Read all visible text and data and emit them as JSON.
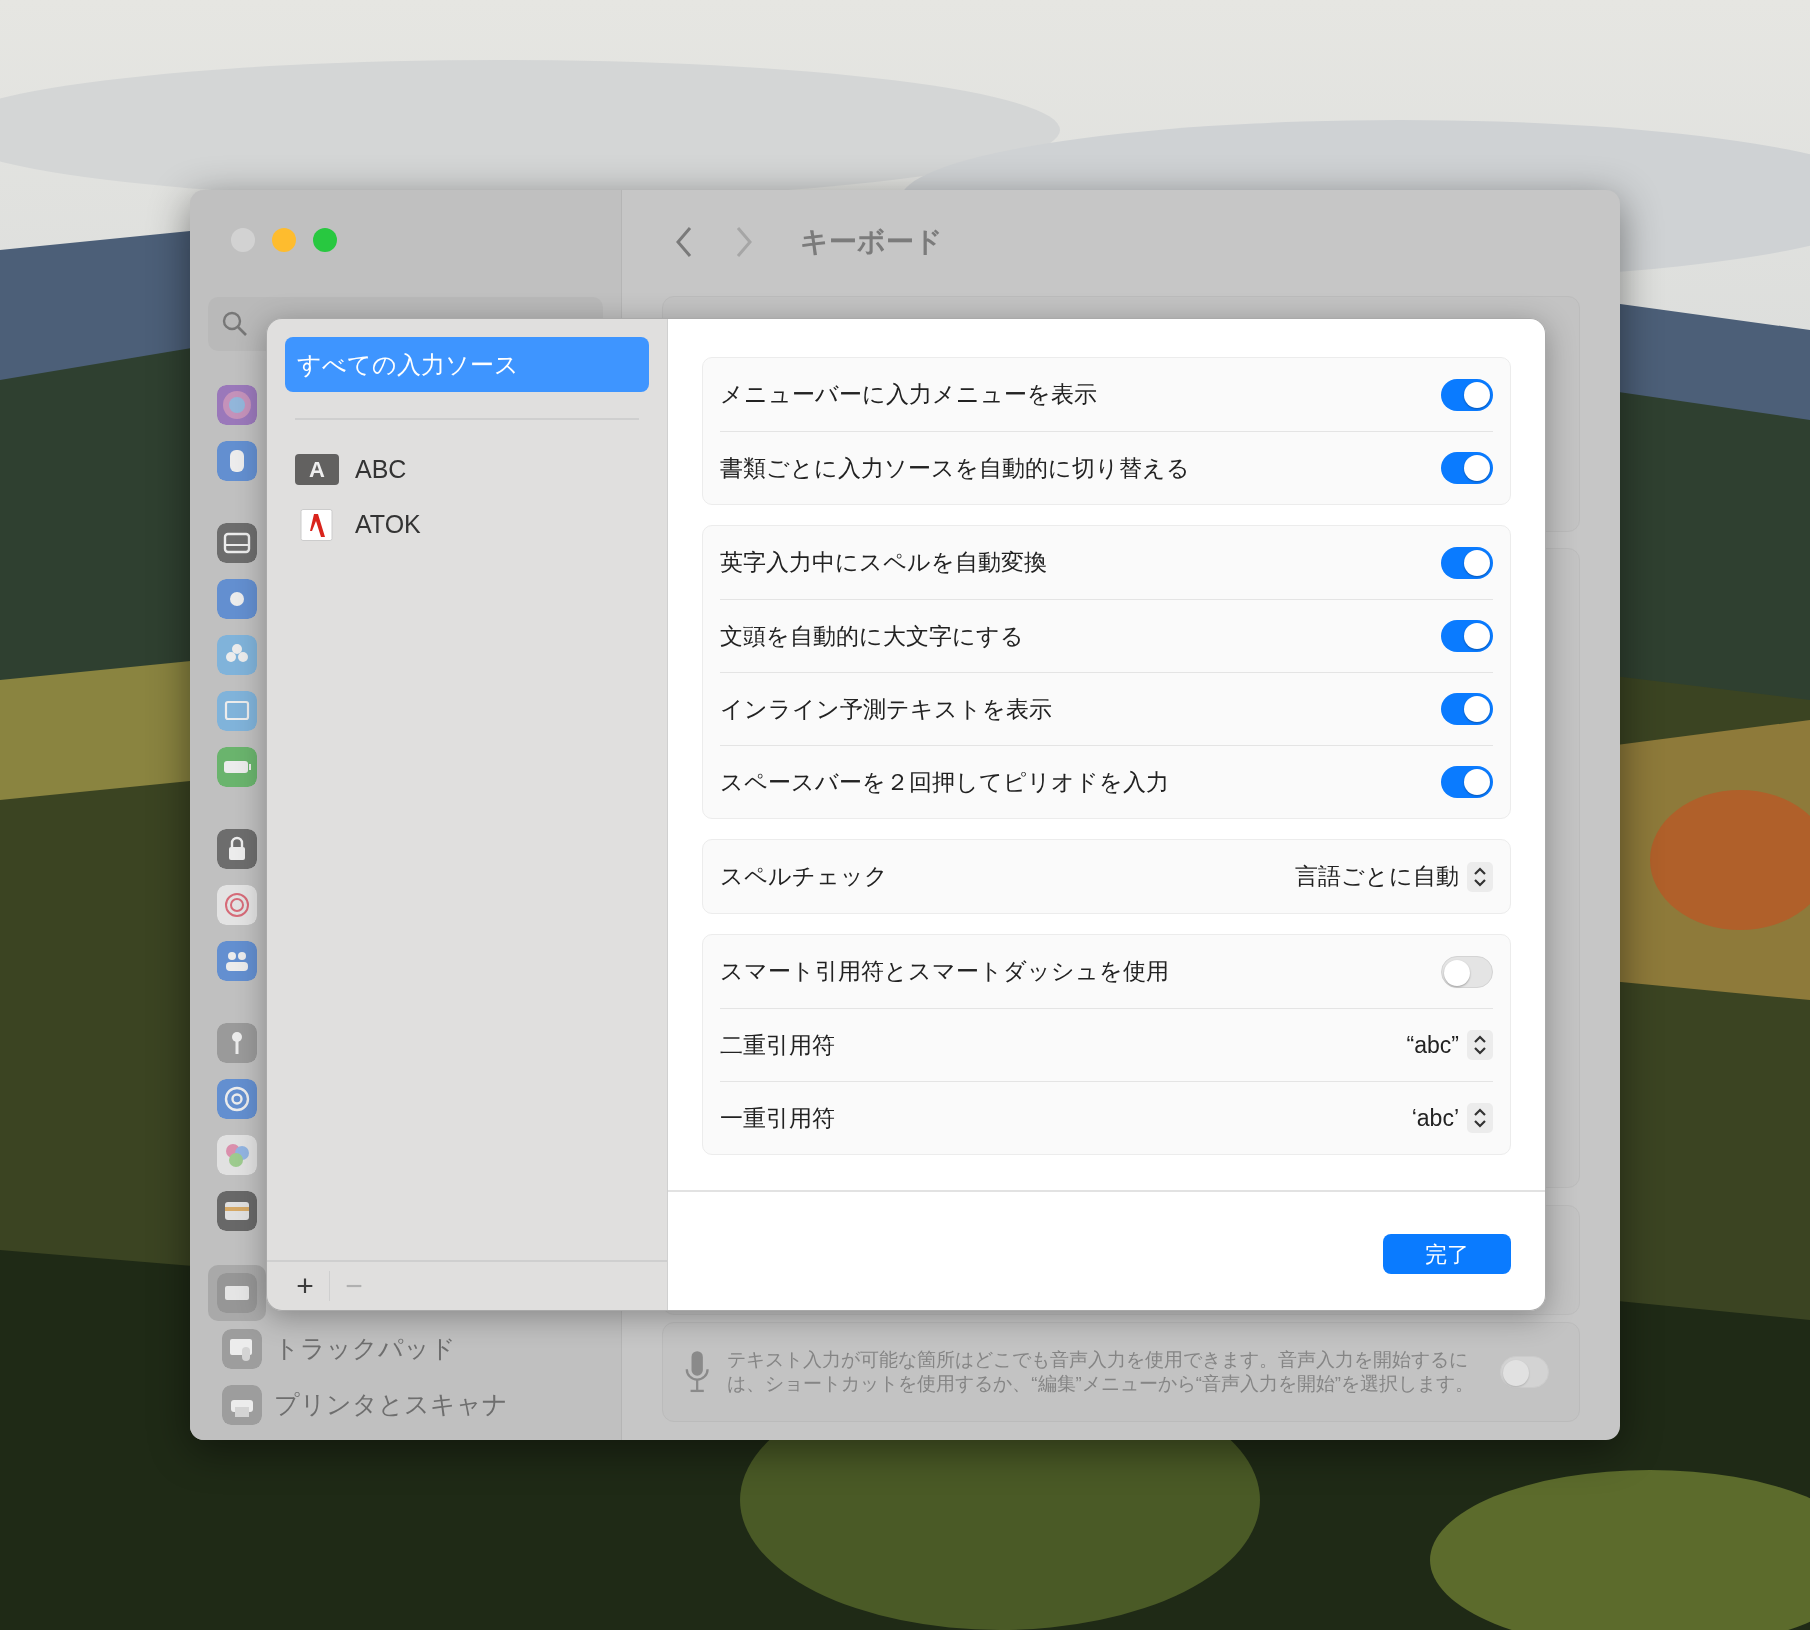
{
  "window": {
    "title": "キーボード"
  },
  "sidebar": {
    "sections": [
      {
        "items": [
          {
            "selected": false
          },
          {
            "selected": false
          }
        ]
      },
      {
        "items": [
          {
            "selected": false
          },
          {
            "selected": false
          },
          {
            "selected": false
          },
          {
            "selected": false
          },
          {
            "selected": false
          }
        ]
      },
      {
        "items": [
          {
            "selected": false
          },
          {
            "selected": false
          },
          {
            "selected": false
          }
        ]
      },
      {
        "items": [
          {
            "selected": false
          },
          {
            "selected": false
          },
          {
            "selected": false
          },
          {
            "selected": false
          }
        ]
      },
      {
        "items": [
          {
            "selected": true
          },
          {
            "label": "トラックパッド",
            "selected": false
          },
          {
            "label": "プリンタとスキャナ",
            "selected": false
          }
        ]
      }
    ]
  },
  "dictation": {
    "text": "テキスト入力が可能な箇所はどこでも音声入力を使用できます。音声入力を開始するには、ショートカットを使用するか、“編集”メニューから“音声入力を開始”を選択します。",
    "on": false
  },
  "sheet": {
    "sources": [
      {
        "kind": "all",
        "label": "すべての入力ソース",
        "selected": true
      },
      {
        "kind": "abc",
        "badge": "A",
        "label": "ABC",
        "selected": false
      },
      {
        "kind": "atok",
        "label": "ATOK",
        "selected": false
      }
    ],
    "toolbar": [
      {
        "label": "+",
        "disabled": false
      },
      {
        "label": "−",
        "disabled": true
      }
    ],
    "groups": [
      {
        "rows": [
          {
            "kind": "toggle",
            "label": "メニューバーに入力メニューを表示",
            "on": true
          },
          {
            "kind": "toggle",
            "label": "書類ごとに入力ソースを自動的に切り替える",
            "on": true
          }
        ]
      },
      {
        "rows": [
          {
            "kind": "toggle",
            "label": "英字入力中にスペルを自動変換",
            "on": true
          },
          {
            "kind": "toggle",
            "label": "文頭を自動的に大文字にする",
            "on": true
          },
          {
            "kind": "toggle",
            "label": "インライン予測テキストを表示",
            "on": true
          },
          {
            "kind": "toggle",
            "label": "スペースバーを２回押してピリオドを入力",
            "on": true
          }
        ]
      },
      {
        "rows": [
          {
            "kind": "popup",
            "label": "スペルチェック",
            "value": "言語ごとに自動"
          }
        ]
      },
      {
        "rows": [
          {
            "kind": "toggle",
            "label": "スマート引用符とスマートダッシュを使用",
            "on": false
          },
          {
            "kind": "popup",
            "label": "二重引用符",
            "value": "“abc”"
          },
          {
            "kind": "popup",
            "label": "一重引用符",
            "value": "‘abc’"
          }
        ]
      }
    ],
    "done_button": "完了"
  }
}
